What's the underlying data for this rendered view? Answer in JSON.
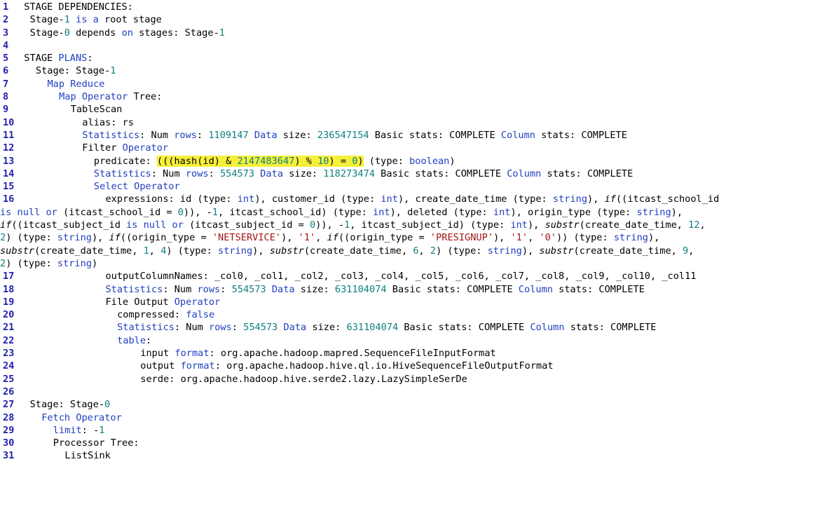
{
  "lines": [
    {
      "n": "1",
      "indent": 1,
      "segs": [
        {
          "t": "STAGE DEPENDENCIES:"
        }
      ]
    },
    {
      "n": "2",
      "indent": 2,
      "segs": [
        {
          "t": "Stage-"
        },
        {
          "t": "1",
          "c": "n"
        },
        {
          "t": " "
        },
        {
          "t": "is a",
          "c": "k"
        },
        {
          "t": " root stage"
        }
      ]
    },
    {
      "n": "3",
      "indent": 2,
      "segs": [
        {
          "t": "Stage-"
        },
        {
          "t": "0",
          "c": "n"
        },
        {
          "t": " depends "
        },
        {
          "t": "on",
          "c": "k"
        },
        {
          "t": " stages: Stage-"
        },
        {
          "t": "1",
          "c": "n"
        }
      ]
    },
    {
      "n": "4",
      "indent": 0,
      "segs": []
    },
    {
      "n": "5",
      "indent": 1,
      "segs": [
        {
          "t": "STAGE "
        },
        {
          "t": "PLANS",
          "c": "k"
        },
        {
          "t": ":"
        }
      ]
    },
    {
      "n": "6",
      "indent": 3,
      "segs": [
        {
          "t": "Stage: Stage-"
        },
        {
          "t": "1",
          "c": "n"
        }
      ]
    },
    {
      "n": "7",
      "indent": 5,
      "segs": [
        {
          "t": "Map Reduce",
          "c": "k"
        }
      ]
    },
    {
      "n": "8",
      "indent": 7,
      "segs": [
        {
          "t": "Map Operator",
          "c": "k"
        },
        {
          "t": " Tree:"
        }
      ]
    },
    {
      "n": "9",
      "indent": 9,
      "segs": [
        {
          "t": "TableScan"
        }
      ]
    },
    {
      "n": "10",
      "indent": 11,
      "segs": [
        {
          "t": "alias: rs"
        }
      ]
    },
    {
      "n": "11",
      "indent": 11,
      "segs": [
        {
          "t": "Statistics",
          "c": "k"
        },
        {
          "t": ": Num "
        },
        {
          "t": "rows",
          "c": "k"
        },
        {
          "t": ": "
        },
        {
          "t": "1109147",
          "c": "n"
        },
        {
          "t": " "
        },
        {
          "t": "Data",
          "c": "k"
        },
        {
          "t": " size: "
        },
        {
          "t": "236547154",
          "c": "n"
        },
        {
          "t": " Basic stats: COMPLETE "
        },
        {
          "t": "Column",
          "c": "k"
        },
        {
          "t": " stats: COMPLETE"
        }
      ]
    },
    {
      "n": "12",
      "indent": 11,
      "segs": [
        {
          "t": "Filter "
        },
        {
          "t": "Operator",
          "c": "k"
        }
      ]
    },
    {
      "n": "13",
      "indent": 13,
      "segs": [
        {
          "t": "predicate: "
        },
        {
          "t": "(((hash(id) & ",
          "hl": true
        },
        {
          "t": "2147483647",
          "c": "n",
          "hl": true
        },
        {
          "t": ") % ",
          "hl": true
        },
        {
          "t": "10",
          "c": "n",
          "hl": true
        },
        {
          "t": ") = ",
          "hl": true
        },
        {
          "t": "0",
          "c": "n",
          "hl": true
        },
        {
          "t": ")",
          "hl": true
        },
        {
          "t": " (type: "
        },
        {
          "t": "boolean",
          "c": "k"
        },
        {
          "t": ")"
        }
      ]
    },
    {
      "n": "14",
      "indent": 13,
      "segs": [
        {
          "t": "Statistics",
          "c": "k"
        },
        {
          "t": ": Num "
        },
        {
          "t": "rows",
          "c": "k"
        },
        {
          "t": ": "
        },
        {
          "t": "554573",
          "c": "n"
        },
        {
          "t": " "
        },
        {
          "t": "Data",
          "c": "k"
        },
        {
          "t": " size: "
        },
        {
          "t": "118273474",
          "c": "n"
        },
        {
          "t": " Basic stats: COMPLETE "
        },
        {
          "t": "Column",
          "c": "k"
        },
        {
          "t": " stats: COMPLETE"
        }
      ]
    },
    {
      "n": "15",
      "indent": 13,
      "segs": [
        {
          "t": "Select Operator",
          "c": "k"
        }
      ]
    },
    {
      "n": "16",
      "indent": 15,
      "segs": [
        {
          "t": "expressions: id (type: "
        },
        {
          "t": "int",
          "c": "k"
        },
        {
          "t": "), customer_id (type: "
        },
        {
          "t": "int",
          "c": "k"
        },
        {
          "t": "), create_date_time (type: "
        },
        {
          "t": "string",
          "c": "k"
        },
        {
          "t": "), "
        },
        {
          "t": "if",
          "c": "i"
        },
        {
          "t": "((itcast_school_id"
        }
      ]
    },
    {
      "n": "",
      "indent": 0,
      "segs": [
        {
          "t": "is null",
          "c": "k"
        },
        {
          "t": " "
        },
        {
          "t": "or",
          "c": "k"
        },
        {
          "t": " (itcast_school_id = "
        },
        {
          "t": "0",
          "c": "n"
        },
        {
          "t": ")), -"
        },
        {
          "t": "1",
          "c": "n"
        },
        {
          "t": ", itcast_school_id) (type: "
        },
        {
          "t": "int",
          "c": "k"
        },
        {
          "t": "), deleted (type: "
        },
        {
          "t": "int",
          "c": "k"
        },
        {
          "t": "), origin_type (type: "
        },
        {
          "t": "string",
          "c": "k"
        },
        {
          "t": "),"
        }
      ]
    },
    {
      "n": "",
      "indent": 0,
      "segs": [
        {
          "t": "if",
          "c": "i"
        },
        {
          "t": "((itcast_subject_id "
        },
        {
          "t": "is null",
          "c": "k"
        },
        {
          "t": " "
        },
        {
          "t": "or",
          "c": "k"
        },
        {
          "t": " (itcast_subject_id = "
        },
        {
          "t": "0",
          "c": "n"
        },
        {
          "t": ")), -"
        },
        {
          "t": "1",
          "c": "n"
        },
        {
          "t": ", itcast_subject_id) (type: "
        },
        {
          "t": "int",
          "c": "k"
        },
        {
          "t": "), "
        },
        {
          "t": "substr",
          "c": "i"
        },
        {
          "t": "(create_date_time, "
        },
        {
          "t": "12",
          "c": "n"
        },
        {
          "t": ","
        }
      ]
    },
    {
      "n": "",
      "indent": 0,
      "segs": [
        {
          "t": "2",
          "c": "n"
        },
        {
          "t": ") (type: "
        },
        {
          "t": "string",
          "c": "k"
        },
        {
          "t": "), "
        },
        {
          "t": "if",
          "c": "i"
        },
        {
          "t": "((origin_type = "
        },
        {
          "t": "'NETSERVICE'",
          "c": "s"
        },
        {
          "t": "), "
        },
        {
          "t": "'1'",
          "c": "s"
        },
        {
          "t": ", "
        },
        {
          "t": "if",
          "c": "i"
        },
        {
          "t": "((origin_type = "
        },
        {
          "t": "'PRESIGNUP'",
          "c": "s"
        },
        {
          "t": "), "
        },
        {
          "t": "'1'",
          "c": "s"
        },
        {
          "t": ", "
        },
        {
          "t": "'0'",
          "c": "s"
        },
        {
          "t": ")) (type: "
        },
        {
          "t": "string",
          "c": "k"
        },
        {
          "t": "),"
        }
      ]
    },
    {
      "n": "",
      "indent": 0,
      "segs": [
        {
          "t": "substr",
          "c": "i"
        },
        {
          "t": "(create_date_time, "
        },
        {
          "t": "1",
          "c": "n"
        },
        {
          "t": ", "
        },
        {
          "t": "4",
          "c": "n"
        },
        {
          "t": ") (type: "
        },
        {
          "t": "string",
          "c": "k"
        },
        {
          "t": "), "
        },
        {
          "t": "substr",
          "c": "i"
        },
        {
          "t": "(create_date_time, "
        },
        {
          "t": "6",
          "c": "n"
        },
        {
          "t": ", "
        },
        {
          "t": "2",
          "c": "n"
        },
        {
          "t": ") (type: "
        },
        {
          "t": "string",
          "c": "k"
        },
        {
          "t": "), "
        },
        {
          "t": "substr",
          "c": "i"
        },
        {
          "t": "(create_date_time, "
        },
        {
          "t": "9",
          "c": "n"
        },
        {
          "t": ","
        }
      ]
    },
    {
      "n": "",
      "indent": 0,
      "segs": [
        {
          "t": "2",
          "c": "n"
        },
        {
          "t": ") (type: "
        },
        {
          "t": "string",
          "c": "k"
        },
        {
          "t": ")"
        }
      ]
    },
    {
      "n": "17",
      "indent": 15,
      "segs": [
        {
          "t": "outputColumnNames: _col0, _col1, _col2, _col3, _col4, _col5, _col6, _col7, _col8, _col9, _col10, _col11"
        }
      ]
    },
    {
      "n": "18",
      "indent": 15,
      "segs": [
        {
          "t": "Statistics",
          "c": "k"
        },
        {
          "t": ": Num "
        },
        {
          "t": "rows",
          "c": "k"
        },
        {
          "t": ": "
        },
        {
          "t": "554573",
          "c": "n"
        },
        {
          "t": " "
        },
        {
          "t": "Data",
          "c": "k"
        },
        {
          "t": " size: "
        },
        {
          "t": "631104074",
          "c": "n"
        },
        {
          "t": " Basic stats: COMPLETE "
        },
        {
          "t": "Column",
          "c": "k"
        },
        {
          "t": " stats: COMPLETE"
        }
      ]
    },
    {
      "n": "19",
      "indent": 15,
      "segs": [
        {
          "t": "File Output "
        },
        {
          "t": "Operator",
          "c": "k"
        }
      ]
    },
    {
      "n": "20",
      "indent": 17,
      "segs": [
        {
          "t": "compressed: "
        },
        {
          "t": "false",
          "c": "k"
        }
      ]
    },
    {
      "n": "21",
      "indent": 17,
      "segs": [
        {
          "t": "Statistics",
          "c": "k"
        },
        {
          "t": ": Num "
        },
        {
          "t": "rows",
          "c": "k"
        },
        {
          "t": ": "
        },
        {
          "t": "554573",
          "c": "n"
        },
        {
          "t": " "
        },
        {
          "t": "Data",
          "c": "k"
        },
        {
          "t": " size: "
        },
        {
          "t": "631104074",
          "c": "n"
        },
        {
          "t": " Basic stats: COMPLETE "
        },
        {
          "t": "Column",
          "c": "k"
        },
        {
          "t": " stats: COMPLETE"
        }
      ]
    },
    {
      "n": "22",
      "indent": 17,
      "segs": [
        {
          "t": "table",
          "c": "k"
        },
        {
          "t": ":"
        }
      ]
    },
    {
      "n": "23",
      "indent": 21,
      "segs": [
        {
          "t": "input "
        },
        {
          "t": "format",
          "c": "k"
        },
        {
          "t": ": org.apache.hadoop.mapred.SequenceFileInputFormat"
        }
      ]
    },
    {
      "n": "24",
      "indent": 21,
      "segs": [
        {
          "t": "output "
        },
        {
          "t": "format",
          "c": "k"
        },
        {
          "t": ": org.apache.hadoop.hive.ql.io.HiveSequenceFileOutputFormat"
        }
      ]
    },
    {
      "n": "25",
      "indent": 21,
      "segs": [
        {
          "t": "serde: org.apache.hadoop.hive.serde2.lazy.LazySimpleSerDe"
        }
      ]
    },
    {
      "n": "26",
      "indent": 0,
      "segs": []
    },
    {
      "n": "27",
      "indent": 2,
      "segs": [
        {
          "t": "Stage: Stage-"
        },
        {
          "t": "0",
          "c": "n"
        }
      ]
    },
    {
      "n": "28",
      "indent": 4,
      "segs": [
        {
          "t": "Fetch Operator",
          "c": "k"
        }
      ]
    },
    {
      "n": "29",
      "indent": 6,
      "segs": [
        {
          "t": "limit",
          "c": "k"
        },
        {
          "t": ": -"
        },
        {
          "t": "1",
          "c": "n"
        }
      ]
    },
    {
      "n": "30",
      "indent": 6,
      "segs": [
        {
          "t": "Processor Tree:"
        }
      ]
    },
    {
      "n": "31",
      "indent": 8,
      "segs": [
        {
          "t": "ListSink"
        }
      ]
    }
  ]
}
